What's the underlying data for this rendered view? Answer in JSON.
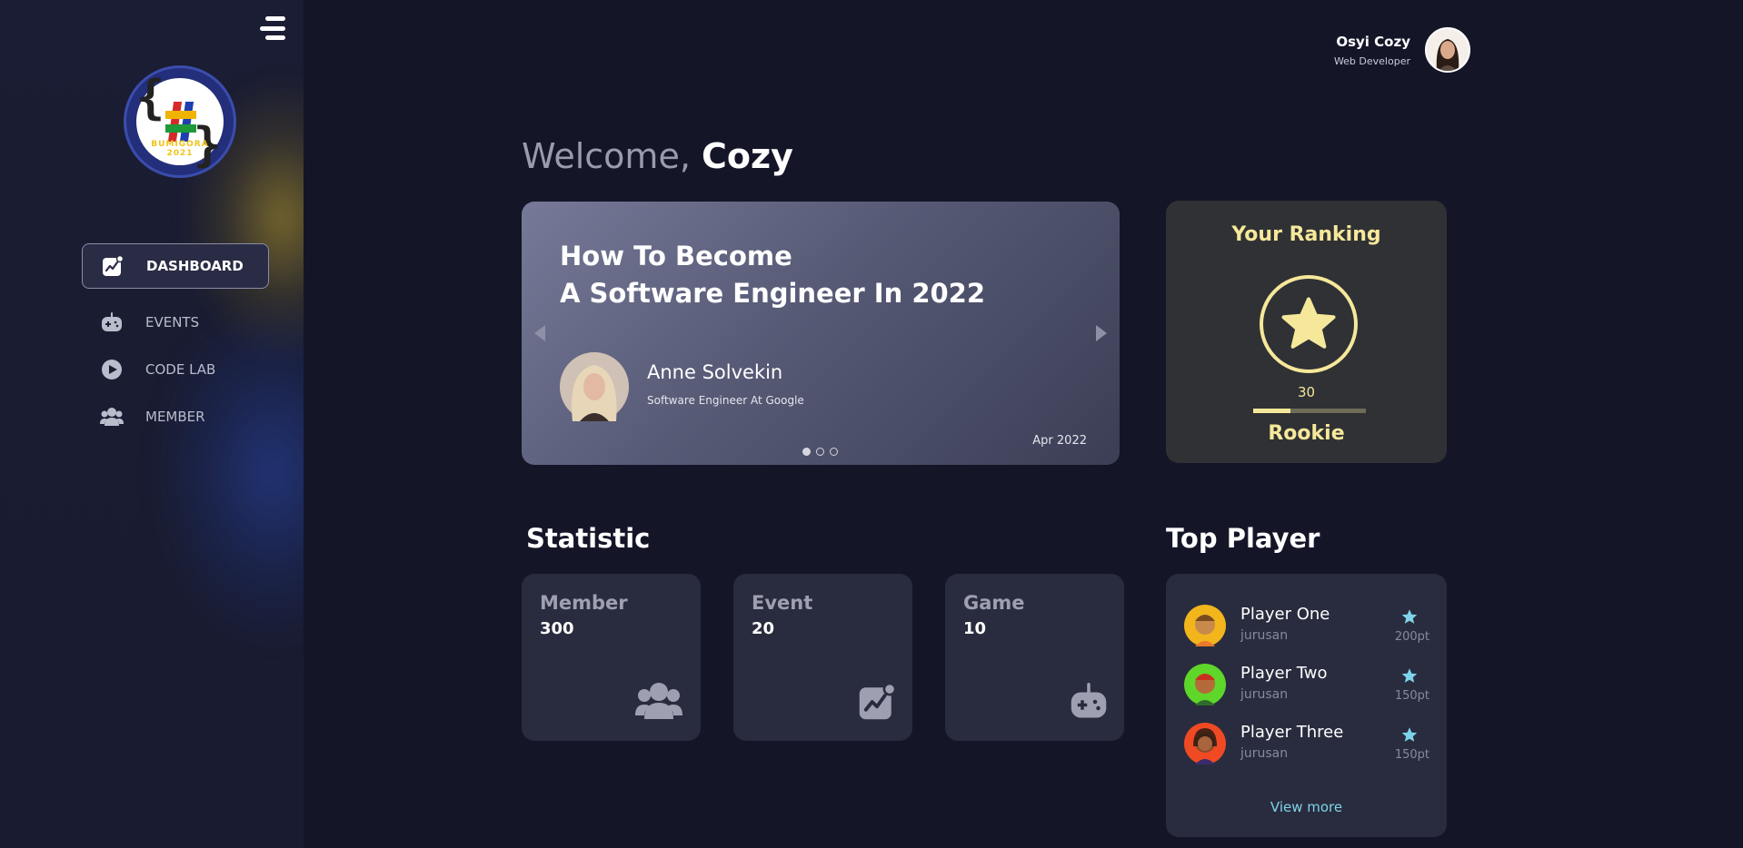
{
  "sidebar": {
    "logo_text": "BUMIGORA 2021",
    "nav": [
      {
        "label": "DASHBOARD",
        "icon": "chart-icon",
        "active": true
      },
      {
        "label": "EVENTS",
        "icon": "gamepad-icon",
        "active": false
      },
      {
        "label": "CODE LAB",
        "icon": "play-icon",
        "active": false
      },
      {
        "label": "MEMBER",
        "icon": "users-icon",
        "active": false
      }
    ]
  },
  "user": {
    "name": "Osyi Cozy",
    "role": "Web Developer"
  },
  "welcome": {
    "prefix": "Welcome,",
    "name": "Cozy"
  },
  "carousel": {
    "title_line1": "How To Become",
    "title_line2": "A Software Engineer In 2022",
    "author": "Anne Solvekin",
    "author_role": "Software Engineer At Google",
    "date": "Apr 2022",
    "slides": 3,
    "active_slide": 1
  },
  "ranking": {
    "title": "Your Ranking",
    "score": "30",
    "progress": 0.33,
    "level": "Rookie"
  },
  "statistic": {
    "title": "Statistic",
    "cards": [
      {
        "label": "Member",
        "value": "300",
        "icon": "users-icon"
      },
      {
        "label": "Event",
        "value": "20",
        "icon": "chart-icon"
      },
      {
        "label": "Game",
        "value": "10",
        "icon": "gamepad-icon"
      }
    ]
  },
  "top_player": {
    "title": "Top Player",
    "players": [
      {
        "name": "Player One",
        "dept": "jurusan",
        "points": "200pt"
      },
      {
        "name": "Player Two",
        "dept": "jurusan",
        "points": "150pt"
      },
      {
        "name": "Player Three",
        "dept": "jurusan",
        "points": "150pt"
      }
    ],
    "view_more": "View more"
  },
  "colors": {
    "background": "#141628",
    "card": "#292c3e",
    "ranking_accent": "#f6e89a",
    "link": "#7ed3e9",
    "star": "#7ed3e9"
  }
}
